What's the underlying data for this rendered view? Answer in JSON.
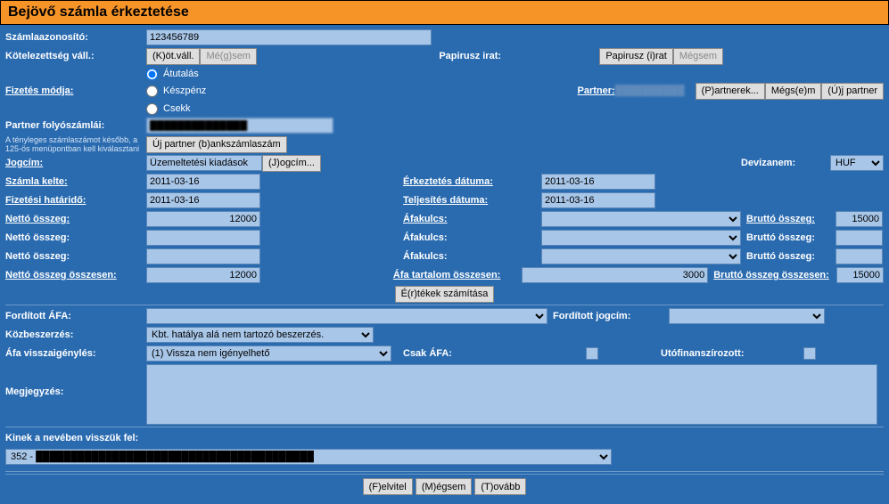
{
  "title": "Bejövő számla érkeztetése",
  "labels": {
    "szamlaazon": "Számlaazonosító:",
    "kotvall": "Kötelezettség váll.:",
    "fizmod": "Fizetés módja:",
    "papirusz": "Papirusz irat:",
    "partner": "Partner:",
    "folyoszamla": "Partner folyószámlái:",
    "folyoszamla_note": "A tényleges számlaszámot később, a 125-ös menüpontban kell kiválasztani",
    "jogcim": "Jogcím:",
    "devizanem": "Devizanem:",
    "szamla_kelte": "Számla kelte:",
    "erk_datum": "Érkeztetés dátuma:",
    "fiz_hatarido": "Fizetési határidő:",
    "telj_datum": "Teljesítés dátuma:",
    "netto": "Nettó összeg:",
    "afakulcs": "Áfakulcs:",
    "brutto": "Bruttó összeg:",
    "netto_sum": "Nettó összeg összesen:",
    "afa_sum": "Áfa tartalom összesen:",
    "brutto_sum": "Bruttó összeg összesen:",
    "ford_afa": "Fordított ÁFA:",
    "ford_jogcim": "Fordított jogcím:",
    "kozbeszerzes": "Közbeszerzés:",
    "afa_vissza": "Áfa visszaigénylés:",
    "csak_afa": "Csak ÁFA:",
    "utofinansz": "Utófinanszírozott:",
    "megjegyzes": "Megjegyzés:",
    "kinek": "Kinek a nevében visszük fel:"
  },
  "buttons": {
    "kotvall": "(K)öt.váll.",
    "megsem1": "Mé(g)sem",
    "papirusz": "Papirusz (i)rat",
    "megsem2": "Mégsem",
    "partnerek": "(P)artnerek...",
    "megsem3": "Mégs(e)m",
    "ujpartner": "(Ú)j partner",
    "ujbank": "Új partner (b)ankszámlaszám",
    "jogcim": "(J)ogcím...",
    "ertekek": "É(r)tékek számítása",
    "felvitel": "(F)elvitel",
    "megsem4": "(M)égsem",
    "tovabb": "(T)ovább"
  },
  "values": {
    "szamlaazon": "123456789",
    "partner_name": "██████████",
    "folyoszamla_val": "██████████████",
    "jogcim_val": "Üzemeltetési kiadások",
    "devizanem": "HUF",
    "szamla_kelte": "2011-03-16",
    "erk_datum": "2011-03-16",
    "fiz_hatarido": "2011-03-16",
    "telj_datum": "2011-03-16",
    "netto1": "12000",
    "brutto1": "15000",
    "netto_sum": "12000",
    "afa_sum": "3000",
    "brutto_sum": "15000",
    "kozbeszerzes_sel": "Kbt. hatálya alá nem tartozó beszerzés.",
    "afa_vissza_sel": "(1) Vissza nem igényelhető",
    "kinek_sel": "352 - ████████████████████████████████████████",
    "megjegyzes": ""
  },
  "radios": {
    "atutalas": "Átutalás",
    "keszpenz": "Készpénz",
    "csekk": "Csekk"
  }
}
